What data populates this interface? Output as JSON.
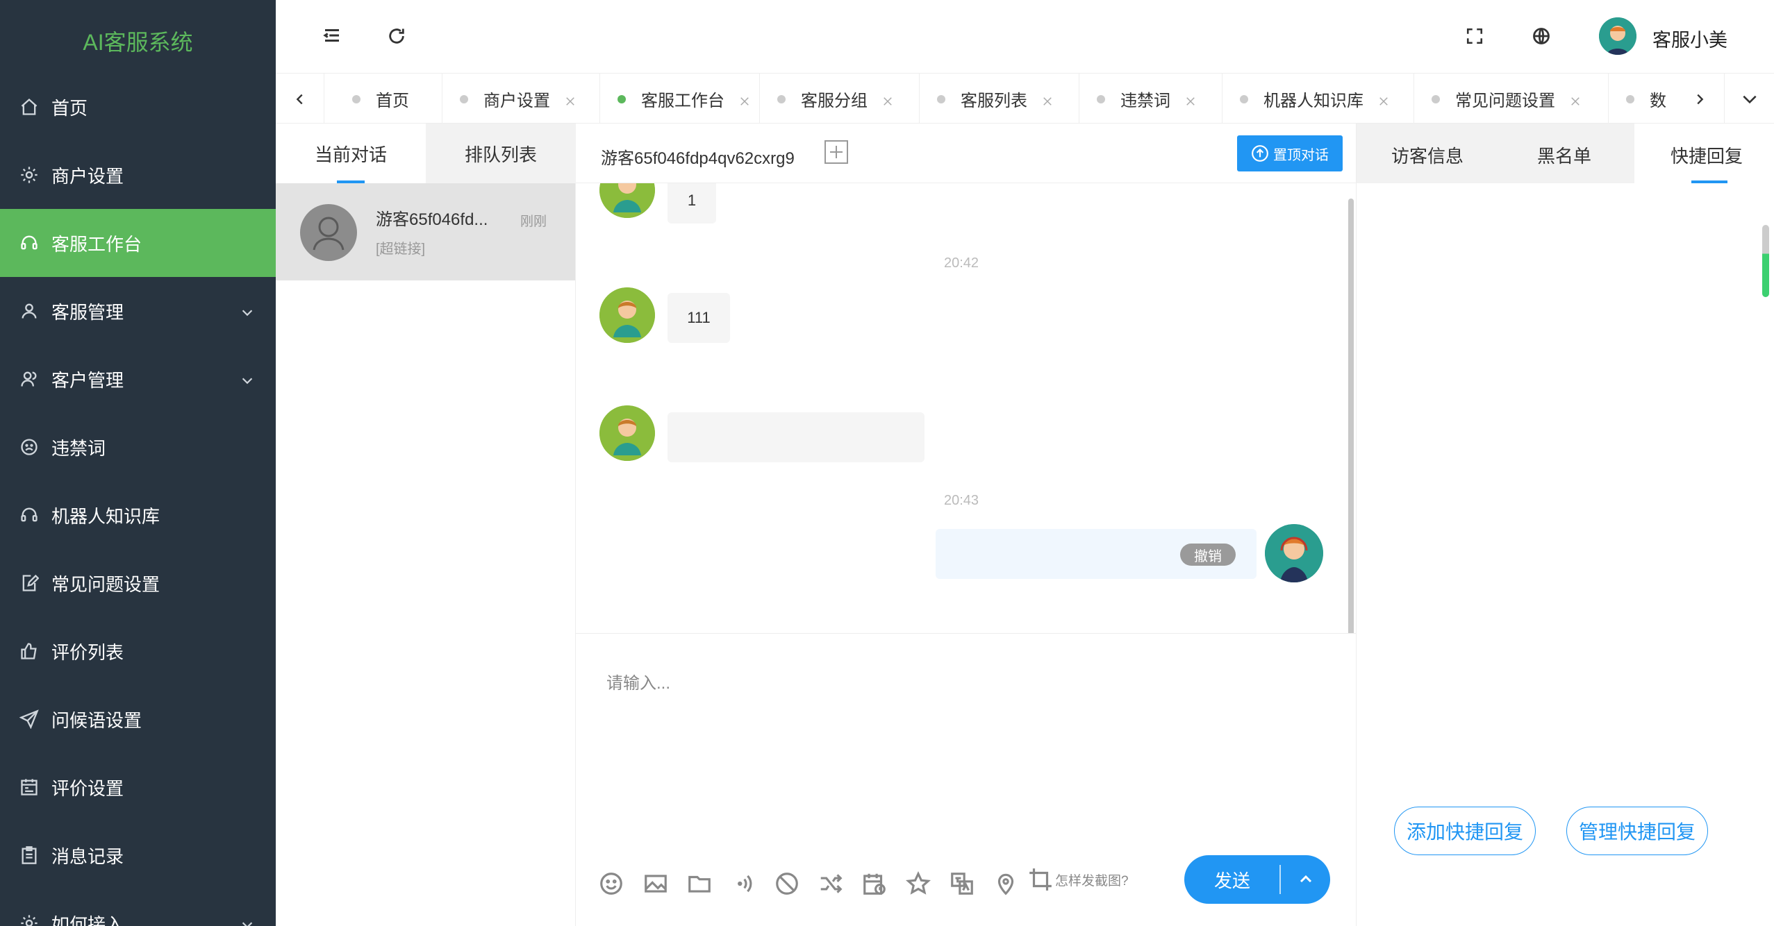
{
  "app": {
    "title": "AI客服系统"
  },
  "sidebar": {
    "items": [
      {
        "label": "首页",
        "icon": "home-icon"
      },
      {
        "label": "商户设置",
        "icon": "gear-icon"
      },
      {
        "label": "客服工作台",
        "icon": "headset-icon",
        "active": true
      },
      {
        "label": "客服管理",
        "icon": "user-icon",
        "expandable": true
      },
      {
        "label": "客户管理",
        "icon": "users-icon",
        "expandable": true
      },
      {
        "label": "违禁词",
        "icon": "frown-icon"
      },
      {
        "label": "机器人知识库",
        "icon": "headset-icon"
      },
      {
        "label": "常见问题设置",
        "icon": "edit-icon"
      },
      {
        "label": "评价列表",
        "icon": "thumb-icon"
      },
      {
        "label": "问候语设置",
        "icon": "send-icon"
      },
      {
        "label": "评价设置",
        "icon": "calendar-icon"
      },
      {
        "label": "消息记录",
        "icon": "clipboard-icon"
      },
      {
        "label": "如何接入",
        "icon": "gear-icon",
        "expandable": true
      }
    ]
  },
  "header": {
    "user_name": "客服小美"
  },
  "tabs": [
    {
      "label": "首页",
      "closable": false,
      "active": false
    },
    {
      "label": "商户设置",
      "closable": true,
      "active": false
    },
    {
      "label": "客服工作台",
      "closable": true,
      "active": true
    },
    {
      "label": "客服分组",
      "closable": true,
      "active": false
    },
    {
      "label": "客服列表",
      "closable": true,
      "active": false
    },
    {
      "label": "违禁词",
      "closable": true,
      "active": false
    },
    {
      "label": "机器人知识库",
      "closable": true,
      "active": false
    },
    {
      "label": "常见问题设置",
      "closable": true,
      "active": false
    },
    {
      "label": "数",
      "closable": false,
      "active": false
    }
  ],
  "conversations": {
    "tab_current": "当前对话",
    "tab_queue": "排队列表",
    "items": [
      {
        "name": "游客65f046fd...",
        "time": "刚刚",
        "preview": "[超链接]"
      }
    ]
  },
  "chat": {
    "visitor_id": "游客65f046fdp4qv62cxrg9",
    "pin_button": "置顶对话",
    "messages": [
      {
        "side": "left",
        "text": "1"
      },
      {
        "timestamp": "20:42"
      },
      {
        "side": "left",
        "text": "111"
      },
      {
        "side": "left",
        "text": ""
      },
      {
        "timestamp": "20:43"
      },
      {
        "side": "right",
        "text": "",
        "recall": "撤销"
      }
    ],
    "input_placeholder": "请输入...",
    "screenshot_help": "怎样发截图?",
    "send_label": "发送"
  },
  "right_panel": {
    "tabs": [
      "访客信息",
      "黑名单",
      "快捷回复"
    ],
    "active_tab": "快捷回复",
    "add_quick_reply": "添加快捷回复",
    "manage_quick_reply": "管理快捷回复"
  },
  "colors": {
    "sidebar_bg": "#283440",
    "accent_green": "#5cb85c",
    "accent_blue": "#2196f3"
  }
}
